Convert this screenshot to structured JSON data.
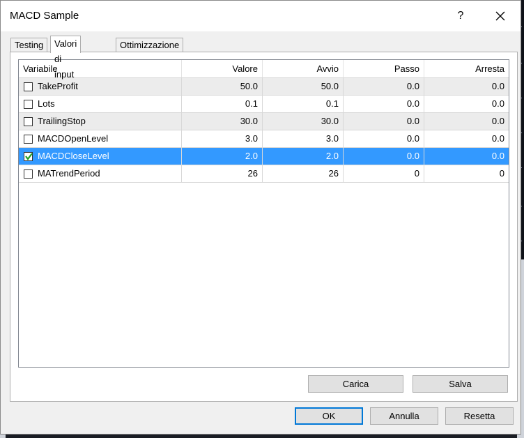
{
  "window": {
    "title": "MACD Sample",
    "help_label": "?",
    "close_label": "✕"
  },
  "tabs": [
    {
      "label": "Testing",
      "active": false
    },
    {
      "label": "Valori di input",
      "active": true
    },
    {
      "label": "Ottimizzazione",
      "active": false
    }
  ],
  "table": {
    "columns": [
      "Variabile",
      "Valore",
      "Avvio",
      "Passo",
      "Arresta"
    ],
    "rows": [
      {
        "name": "TakeProfit",
        "checked": false,
        "valore": "50.0",
        "avvio": "50.0",
        "passo": "0.0",
        "arresta": "0.0",
        "selected": false
      },
      {
        "name": "Lots",
        "checked": false,
        "valore": "0.1",
        "avvio": "0.1",
        "passo": "0.0",
        "arresta": "0.0",
        "selected": false
      },
      {
        "name": "TrailingStop",
        "checked": false,
        "valore": "30.0",
        "avvio": "30.0",
        "passo": "0.0",
        "arresta": "0.0",
        "selected": false
      },
      {
        "name": "MACDOpenLevel",
        "checked": false,
        "valore": "3.0",
        "avvio": "3.0",
        "passo": "0.0",
        "arresta": "0.0",
        "selected": false
      },
      {
        "name": "MACDCloseLevel",
        "checked": true,
        "valore": "2.0",
        "avvio": "2.0",
        "passo": "0.0",
        "arresta": "0.0",
        "selected": true
      },
      {
        "name": "MATrendPeriod",
        "checked": false,
        "valore": "26",
        "avvio": "26",
        "passo": "0",
        "arresta": "0",
        "selected": false
      }
    ]
  },
  "buttons": {
    "carica": "Carica",
    "salva": "Salva",
    "ok": "OK",
    "annulla": "Annulla",
    "resetta": "Resetta"
  },
  "colors": {
    "selection": "#3399ff",
    "checkmark": "#1e9e1e",
    "accent_border": "#0078d7"
  }
}
